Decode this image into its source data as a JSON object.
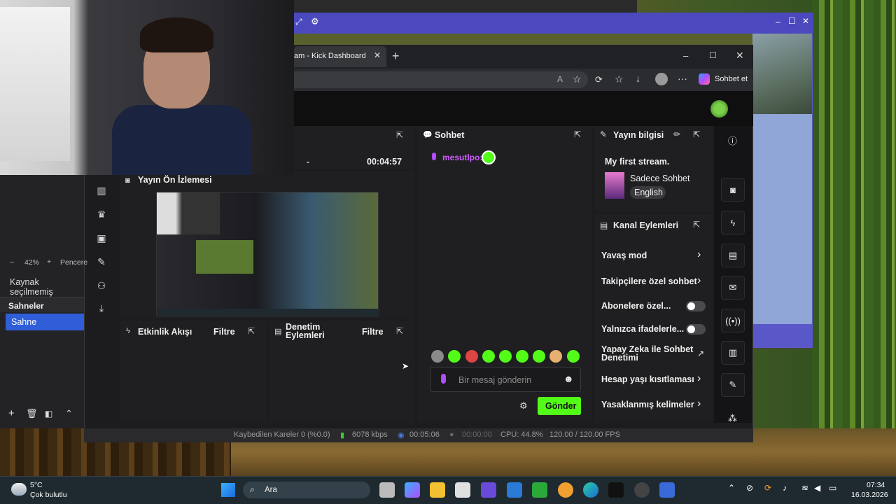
{
  "browser": {
    "tab_title": "am - Kick Dashboard",
    "new_tab": "+",
    "copilot_label": "Sohbet et",
    "window_controls": [
      "–",
      "☐",
      "✕"
    ]
  },
  "dashboard": {
    "top_panel": {
      "dash": "-",
      "timer": "00:04:57"
    },
    "preview": {
      "title": "Yayın Ön İzlemesi"
    },
    "activity": {
      "title": "Etkinlik Akışı",
      "filter": "Filtre"
    },
    "moderation": {
      "title_line1": "Denetim",
      "title_line2": "Eylemleri",
      "filter": "Filtre"
    },
    "chat": {
      "title": "Sohbet",
      "message_user": "mesutlpo:",
      "input_placeholder": "Bir mesaj gönderin",
      "send_label": "Gönder"
    },
    "stream_info": {
      "title": "Yayın bilgisi",
      "stream_title": "My first stream.",
      "category": "Sadece Sohbet",
      "language": "English"
    },
    "channel_actions": {
      "title": "Kanal Eylemleri",
      "items": [
        {
          "label": "Yavaş mod",
          "control": "chevron"
        },
        {
          "label": "Takipçilere özel sohbet",
          "control": "chevron"
        },
        {
          "label": "Abonelere özel...",
          "control": "toggle"
        },
        {
          "label": "Yalnızca ifadelerle...",
          "control": "toggle"
        },
        {
          "label": "Yapay Zeka ile Sohbet Denetimi",
          "control": "external"
        },
        {
          "label": "Hesap yaşı kısıtlaması",
          "control": "chevron"
        },
        {
          "label": "Yasaklanmış kelimeler",
          "control": "chevron"
        }
      ]
    }
  },
  "obs": {
    "zoom": "42%",
    "zoom_minus": "–",
    "zoom_plus": "+",
    "window_label": "Pencere",
    "source_none": "Kaynak seçilmemiş",
    "scenes_title": "Sahneler",
    "scene_item": "Sahne",
    "status": {
      "dropped": "Kaybedilen Kareler 0 (%0.0)",
      "bitrate": "6078 kbps",
      "stream_time": "00:05:06",
      "rec_time": "00:00:00",
      "cpu": "CPU: 44.8%",
      "fps": "120.00 / 120.00 FPS"
    }
  },
  "taskbar": {
    "weather_temp": "5°C",
    "weather_desc": "Çok bulutlu",
    "search_label": "Ara",
    "time": "07:34",
    "date": "16.03.2026"
  },
  "colors": {
    "kick_green": "#53fc18",
    "obs_scene_selected": "#2f5ed8",
    "panel_bg": "#1f1f21"
  }
}
